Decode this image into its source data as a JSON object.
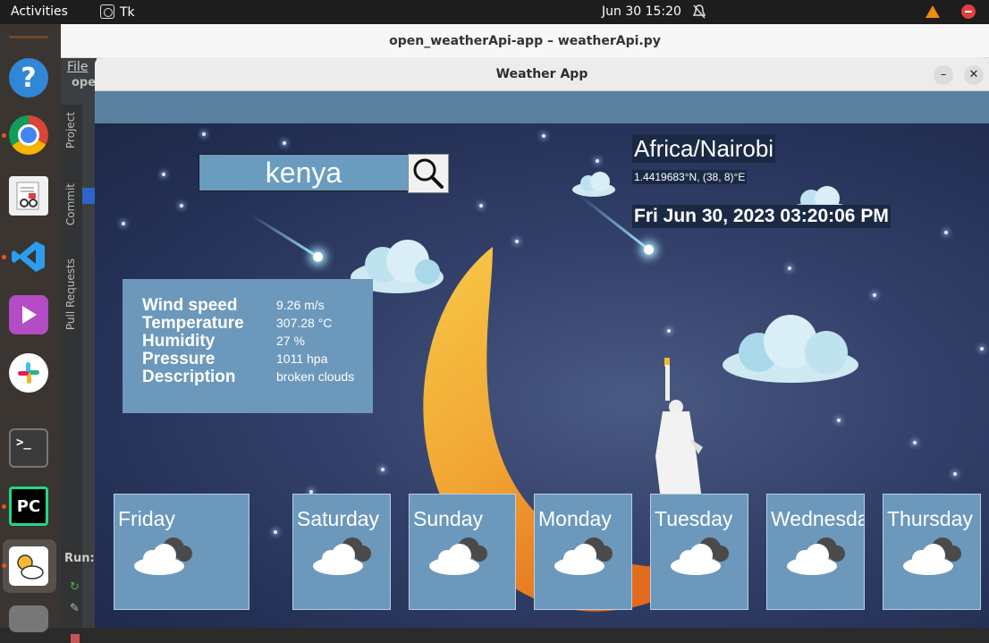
{
  "topbar": {
    "activities": "Activities",
    "app": "Tk",
    "clock": "Jun 30  15:20"
  },
  "dock": {
    "items": [
      "help-icon",
      "chrome-icon",
      "document-viewer-icon",
      "vscode-icon",
      "video-player-icon",
      "slack-icon",
      "terminal-icon",
      "pycharm-icon",
      "weather-app-icon",
      "disk-icon"
    ],
    "terminal_glyph": ">_",
    "pycharm_glyph": "PC"
  },
  "ide": {
    "title": "open_weatherApi-app – weatherApi.py",
    "menu_file": "File",
    "project_short": "ope",
    "side_tabs": [
      "Project",
      "Commit",
      "Pull Requests"
    ],
    "run_label": "Run:"
  },
  "window": {
    "title": "Weather App",
    "minimize": "–",
    "close": "✕"
  },
  "search": {
    "value": "kenya"
  },
  "location": {
    "timezone": "Africa/Nairobi",
    "coords": "1.4419683°N, (38, 8)°E",
    "datetime": "Fri Jun 30, 2023 03:20:06 PM"
  },
  "info": {
    "labels": [
      "Wind speed",
      "Temperature",
      "Humidity",
      "Pressure",
      "Description"
    ],
    "values": [
      "9.26 m/s",
      "307.28 °C",
      "27 %",
      "1011 hpa",
      "broken clouds"
    ]
  },
  "forecast": [
    {
      "day": "Friday",
      "icon": "broken-clouds-icon"
    },
    {
      "day": "Saturday",
      "icon": "broken-clouds-icon"
    },
    {
      "day": "Sunday",
      "icon": "broken-clouds-icon"
    },
    {
      "day": "Monday",
      "icon": "broken-clouds-icon"
    },
    {
      "day": "Tuesday",
      "icon": "broken-clouds-icon"
    },
    {
      "day": "Wednesday",
      "icon": "broken-clouds-icon"
    },
    {
      "day": "Thursday",
      "icon": "broken-clouds-icon"
    }
  ],
  "colors": {
    "card": "#6c98bb",
    "accent_orange": "#e95420",
    "sky": "#243055"
  }
}
